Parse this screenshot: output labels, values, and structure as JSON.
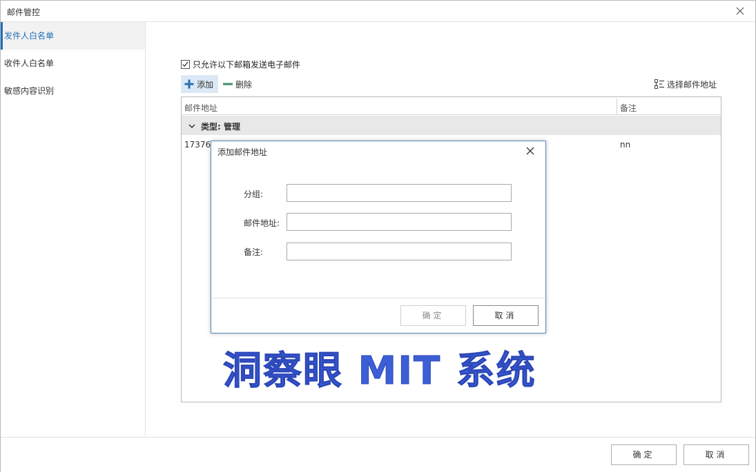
{
  "window": {
    "title": "邮件管控"
  },
  "sidebar": {
    "items": [
      {
        "label": "发件人白名单"
      },
      {
        "label": "收件人白名单"
      },
      {
        "label": "敏感内容识别"
      }
    ]
  },
  "main": {
    "only_allow_checkbox": {
      "label": "只允许以下邮箱发送电子邮件",
      "checked": true
    },
    "toolbar": {
      "add_label": "添加",
      "delete_label": "删除",
      "select_label": "选择邮件地址"
    },
    "table": {
      "columns": [
        "邮件地址",
        "备注"
      ],
      "group_label": "类型: 管理",
      "rows": [
        {
          "email": "173760",
          "note": "nn"
        }
      ]
    }
  },
  "watermark_text": "洞察眼 MIT 系统",
  "footer": {
    "ok_label": "确定",
    "cancel_label": "取消"
  },
  "dialog": {
    "title": "添加邮件地址",
    "fields": [
      {
        "label": "分组:",
        "value": ""
      },
      {
        "label": "邮件地址:",
        "value": ""
      },
      {
        "label": "备注:",
        "value": ""
      }
    ],
    "ok_label": "确定",
    "cancel_label": "取消"
  },
  "colors": {
    "accent": "#1f6fb5",
    "active_bg": "#f2f2f2",
    "add_hover_bg": "#dbe9f6",
    "group_row_bg": "#e8e8e8",
    "watermark": "#3c5fd6",
    "dialog_border": "#5b84b9",
    "add_icon": "#2a6db0",
    "delete_icon": "#3f8f6a"
  },
  "icons": {
    "window_close": "close-icon",
    "add": "plus-icon",
    "delete": "minus-icon",
    "select": "list-select-icon",
    "group_toggle": "chevron-down-icon",
    "checkbox": "checkmark-icon",
    "dialog_close": "close-icon"
  }
}
